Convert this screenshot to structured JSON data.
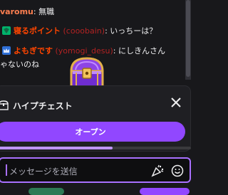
{
  "colors": {
    "background": "#18181b",
    "accent": "#9147ff",
    "username_orange": "#ff4500",
    "username_orange2": "#ff7f50",
    "login_red": "#b22222",
    "message_white": "#efeff1"
  },
  "chat": {
    "messages": [
      {
        "username": "varomu",
        "separator": ": ",
        "text": "無職",
        "color": "#ff7f50"
      },
      {
        "badge_icon": "shield-badge-icon",
        "username": "寝るポイント",
        "login": "(cooobain)",
        "separator": ": ",
        "text": "いっちーは？",
        "color": "#ff4500"
      },
      {
        "badge_icon": "crown-badge-icon",
        "username": "よもぎです",
        "login": "(yomogi_desu)",
        "separator": ": ",
        "text": "にしきんさん",
        "continuation": "ゃないのね",
        "color": "#ff4500"
      }
    ]
  },
  "hype_chest": {
    "title": "ハイプチェスト",
    "open_label": "オープン",
    "progress": 0.6
  },
  "input": {
    "placeholder": "メッセージを送信"
  }
}
